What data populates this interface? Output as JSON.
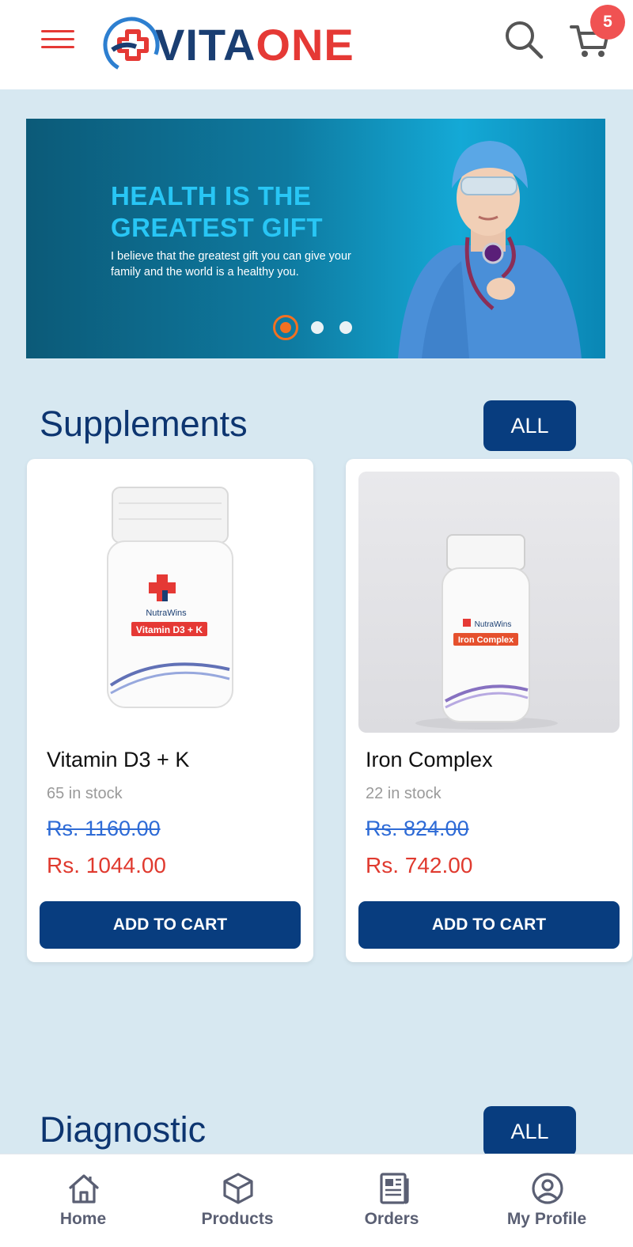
{
  "header": {
    "logo_part1": "VITA",
    "logo_part2": "ONE",
    "cart_count": "5"
  },
  "banner": {
    "title": "HEALTH IS THE GREATEST GIFT",
    "subtitle": "I believe that the greatest gift you can give your family and the world is a healthy you.",
    "slides": 3,
    "active_slide": 1
  },
  "sections": [
    {
      "title": "Supplements",
      "all_label": "ALL"
    },
    {
      "title": "Diagnostic",
      "all_label": "ALL"
    }
  ],
  "products": [
    {
      "name": "Vitamin D3 + K",
      "stock": "65 in stock",
      "old_price": "Rs. 1160.00",
      "new_price": "Rs. 1044.00",
      "button": "ADD TO CART",
      "bottle_brand": "NutraWins",
      "bottle_label": "Vitamin D3 + K"
    },
    {
      "name": "Iron Complex",
      "stock": "22 in stock",
      "old_price": "Rs. 824.00",
      "new_price": "Rs. 742.00",
      "button": "ADD TO CART",
      "bottle_brand": "NutraWins",
      "bottle_label": "Iron Complex"
    }
  ],
  "bottom_nav": [
    {
      "label": "Home",
      "icon": "home-icon"
    },
    {
      "label": "Products",
      "icon": "box-icon"
    },
    {
      "label": "Orders",
      "icon": "newspaper-icon"
    },
    {
      "label": "My Profile",
      "icon": "user-circle-icon"
    }
  ],
  "colors": {
    "brand_navy": "#083d7f",
    "brand_red": "#e53935",
    "accent_orange": "#f37021",
    "page_bg": "#d7e8f1"
  }
}
